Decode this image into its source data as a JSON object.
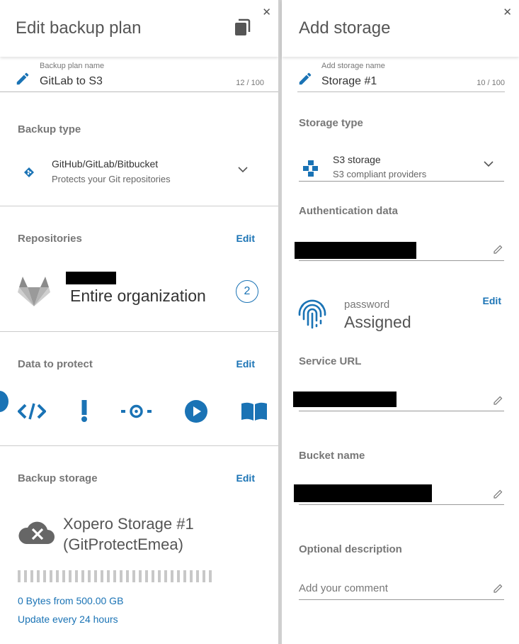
{
  "left": {
    "title": "Edit backup plan",
    "name_field": {
      "label": "Backup plan name",
      "value": "GitLab to S3",
      "counter": "12 / 100"
    },
    "backup_type": {
      "title": "Backup type",
      "selected_primary": "GitHub/GitLab/Bitbucket",
      "selected_secondary": "Protects your Git repositories"
    },
    "repositories": {
      "title": "Repositories",
      "edit": "Edit",
      "scope": "Entire organization",
      "count": "2"
    },
    "data_to_protect": {
      "title": "Data to protect",
      "edit": "Edit",
      "icons": [
        "code-icon",
        "exclamation-icon",
        "commit-icon",
        "play-icon",
        "book-icon"
      ]
    },
    "backup_storage": {
      "title": "Backup storage",
      "edit": "Edit",
      "name_line1": "Xopero Storage #1",
      "name_line2": "(GitProtectEmea)",
      "usage_fraction": 0,
      "usage": "0 Bytes from 500.00 GB",
      "schedule": "Update every 24 hours"
    }
  },
  "right": {
    "title": "Add storage",
    "name_field": {
      "label": "Add storage name",
      "value": "Storage #1",
      "counter": "10 / 100"
    },
    "storage_type": {
      "title": "Storage type",
      "selected_primary": "S3 storage",
      "selected_secondary": "S3 compliant providers"
    },
    "auth": {
      "title": "Authentication data",
      "password_label": "password",
      "password_value": "Assigned",
      "edit": "Edit"
    },
    "service_url": {
      "title": "Service URL"
    },
    "bucket": {
      "title": "Bucket name"
    },
    "description": {
      "title": "Optional description",
      "placeholder": "Add your comment"
    }
  },
  "colors": {
    "accent": "#1a73b5",
    "muted": "#777777",
    "redaction": "#000000"
  }
}
